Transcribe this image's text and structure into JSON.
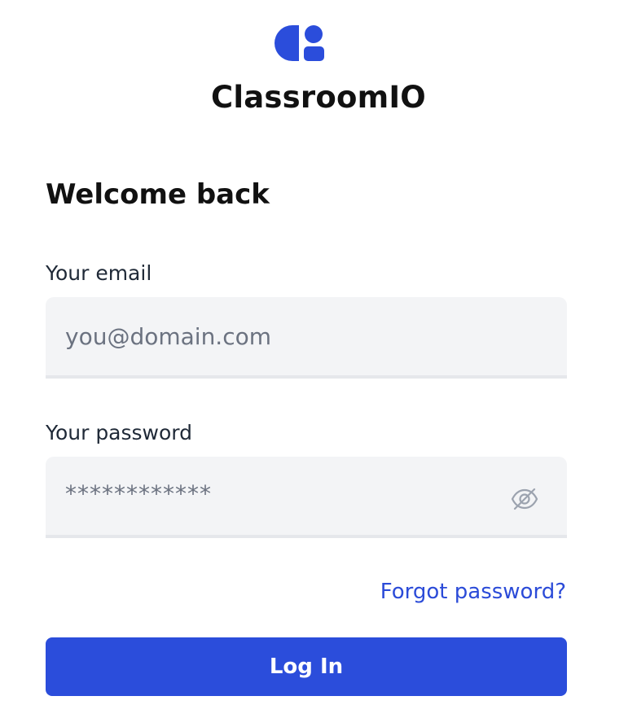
{
  "brand": {
    "app_name": "ClassroomIO",
    "logo_icon": "classroomio-logo-icon",
    "accent_color": "#2B4DDB"
  },
  "login": {
    "title": "Welcome back",
    "email": {
      "label": "Your email",
      "placeholder": "you@domain.com",
      "value": ""
    },
    "password": {
      "label": "Your password",
      "placeholder": "************",
      "value": "",
      "toggle_icon": "eye-off-icon"
    },
    "forgot_password": "Forgot password?",
    "submit": "Log In"
  }
}
